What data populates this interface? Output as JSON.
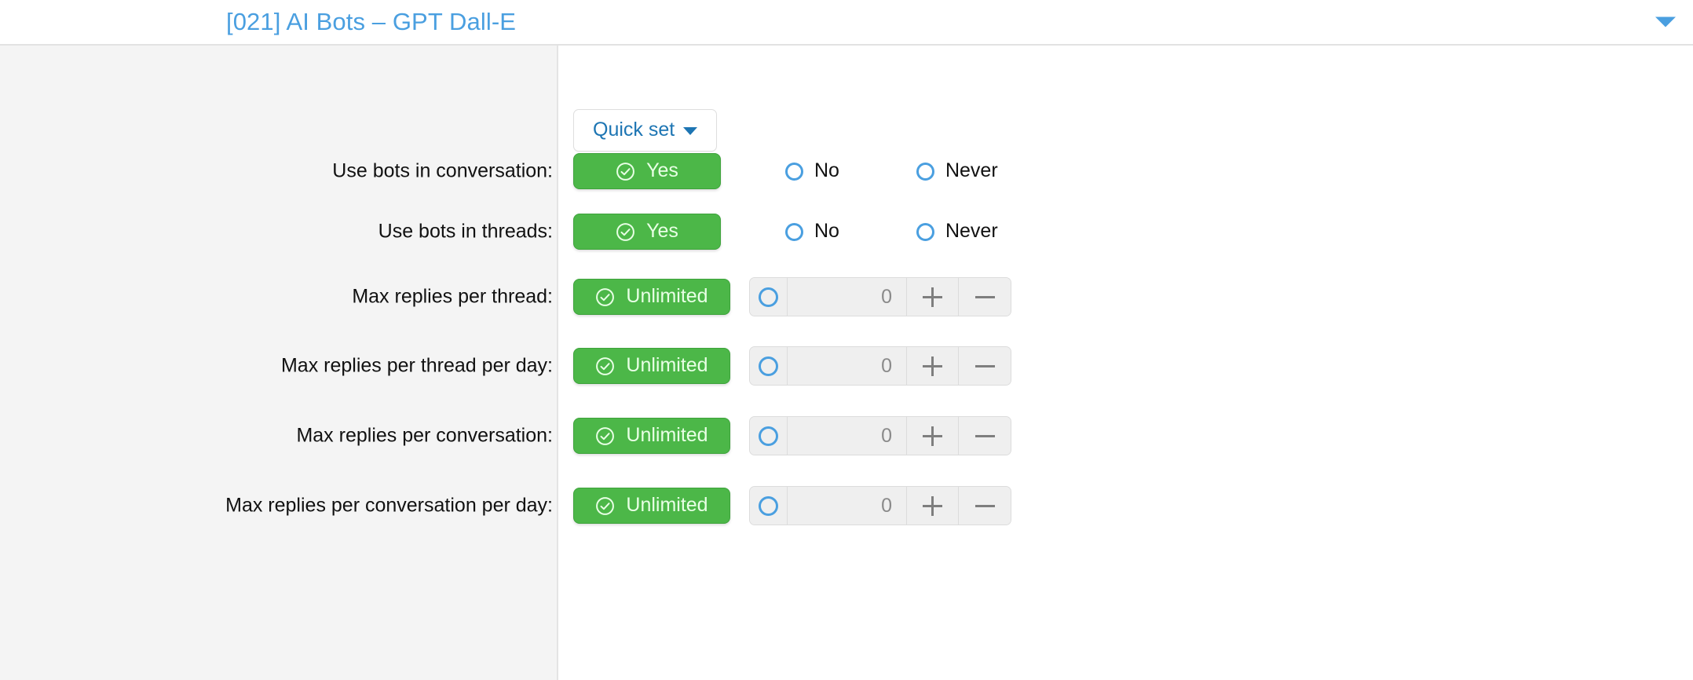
{
  "header": {
    "title": "[021] AI Bots – GPT Dall-E",
    "caret_icon": "chevron-down-icon",
    "accent_color": "#4a9fe0"
  },
  "toolbar": {
    "quick_set_label": "Quick set",
    "quick_set_caret_icon": "caret-down-icon",
    "link_color": "#1d75b3"
  },
  "colors": {
    "selected_green": "#4cb748",
    "radio_blue": "#4a9fe0",
    "label_column_bg": "#f4f4f4",
    "stepper_bg": "#efefef"
  },
  "icons": {
    "check_circle": "check-circle-icon",
    "plus": "plus-icon",
    "minus": "minus-icon",
    "radio_unselected": "radio-unchecked-icon"
  },
  "rows": [
    {
      "id": "use-bots-in-conversation",
      "label": "Use bots in conversation:",
      "type": "choice",
      "selected_label": "Yes",
      "options": [
        "No",
        "Never"
      ]
    },
    {
      "id": "use-bots-in-threads",
      "label": "Use bots in threads:",
      "type": "choice",
      "selected_label": "Yes",
      "options": [
        "No",
        "Never"
      ]
    },
    {
      "id": "max-replies-per-thread",
      "label": "Max replies per thread:",
      "type": "limit",
      "selected_label": "Unlimited",
      "value": "0",
      "plus_label": "+",
      "minus_label": "−"
    },
    {
      "id": "max-replies-per-thread-per-day",
      "label": "Max replies per thread per day:",
      "type": "limit",
      "selected_label": "Unlimited",
      "value": "0",
      "plus_label": "+",
      "minus_label": "−"
    },
    {
      "id": "max-replies-per-conversation",
      "label": "Max replies per conversation:",
      "type": "limit",
      "selected_label": "Unlimited",
      "value": "0",
      "plus_label": "+",
      "minus_label": "−"
    },
    {
      "id": "max-replies-per-conversation-per-day",
      "label": "Max replies per conversation per day:",
      "type": "limit",
      "selected_label": "Unlimited",
      "value": "0",
      "plus_label": "+",
      "minus_label": "−"
    }
  ]
}
